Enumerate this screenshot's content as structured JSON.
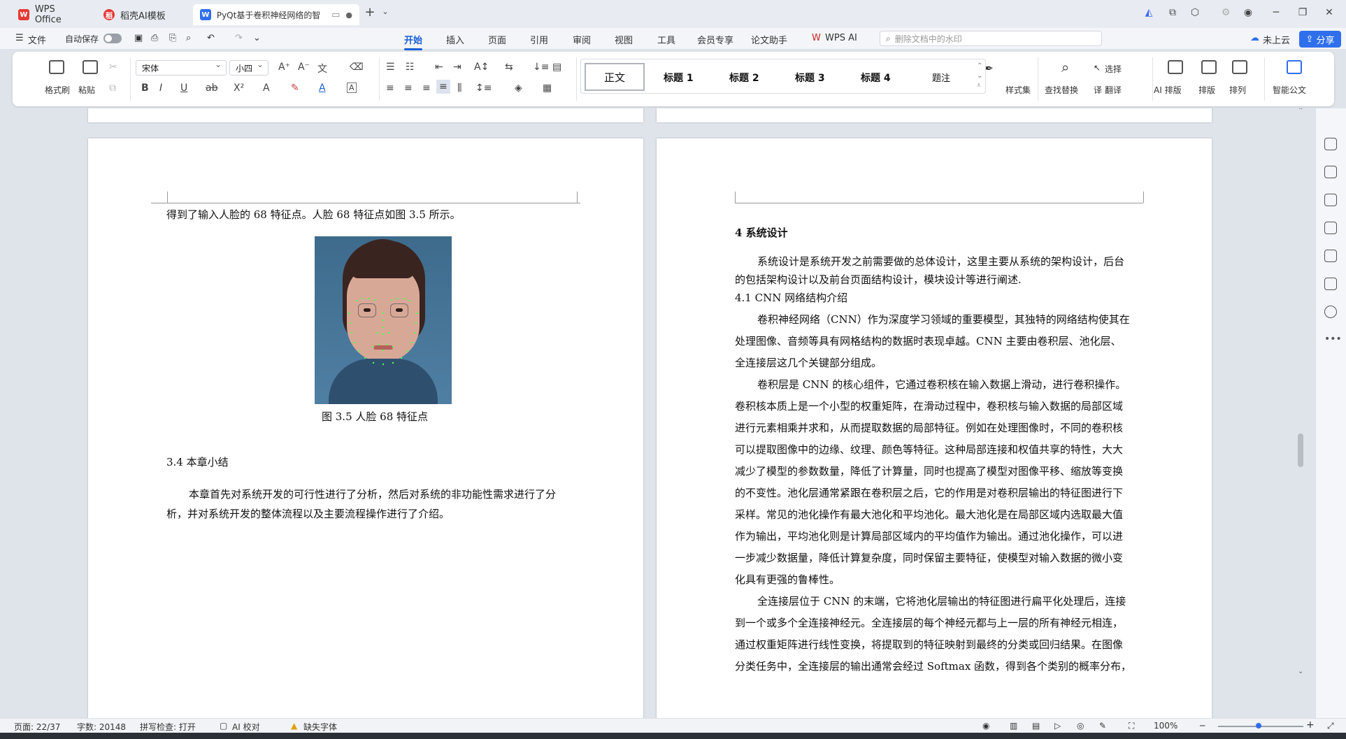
{
  "tabs": [
    {
      "label": "WPS Office"
    },
    {
      "label": "稻壳AI模板"
    },
    {
      "label": "PyQt基于卷积神经网络的智"
    }
  ],
  "menu": {
    "file": "文件",
    "autosave": "自动保存",
    "items": [
      "开始",
      "插入",
      "页面",
      "引用",
      "审阅",
      "视图",
      "工具",
      "会员专享",
      "论文助手",
      "WPS AI"
    ],
    "search_placeholder": "删除文档中的水印",
    "cloud": "未上云",
    "share": "分享"
  },
  "ribbon": {
    "format_painter": "格式刷",
    "paste": "粘贴",
    "font_name": "宋体",
    "font_size": "小四",
    "styles": [
      "正文",
      "标题 1",
      "标题 2",
      "标题 3",
      "标题 4",
      "题注"
    ],
    "style_set": "样式集",
    "find_replace": "查找替换",
    "select": "选择",
    "translate": "翻译",
    "ai_layout": "AI 排版",
    "layout": "排版",
    "arrange": "排列",
    "smart_doc": "智能公文"
  },
  "left_page": {
    "line1": "得到了输入人脸的  68  特征点。人脸  68  特征点如图 3.5  所示。",
    "caption": "图  3.5    人脸  68  特征点",
    "section": "3.4 本章小结",
    "para_l1": "本章首先对系统开发的可行性进行了分析，然后对系统的非功能性需求进行了分",
    "para_l2": "析，并对系统开发的整体流程以及主要流程操作进行了介绍。"
  },
  "right_page": {
    "heading": "4  系统设计",
    "lines": [
      "系统设计是系统开发之前需要做的总体设计，这里主要从系统的架构设计，后台",
      "的包括架构设计以及前台页面结构设计，模块设计等进行阐述.",
      "4.1 CNN   网络结构介绍",
      "卷积神经网络（CNN）作为深度学习领域的重要模型，其独特的网络结构使其在",
      "处理图像、音频等具有网格结构的数据时表现卓越。CNN 主要由卷积层、池化层、",
      "全连接层这几个关键部分组成。",
      "卷积层是  CNN  的核心组件，它通过卷积核在输入数据上滑动，进行卷积操作。",
      "卷积核本质上是一个小型的权重矩阵，在滑动过程中，卷积核与输入数据的局部区域",
      "进行元素相乘并求和，从而提取数据的局部特征。例如在处理图像时，不同的卷积核",
      "可以提取图像中的边缘、纹理、颜色等特征。这种局部连接和权值共享的特性，大大",
      "减少了模型的参数数量，降低了计算量，同时也提高了模型对图像平移、缩放等变换",
      "的不变性。池化层通常紧跟在卷积层之后，它的作用是对卷积层输出的特征图进行下",
      "采样。常见的池化操作有最大池化和平均池化。最大池化是在局部区域内选取最大值",
      "作为输出，平均池化则是计算局部区域内的平均值作为输出。通过池化操作，可以进",
      "一步减少数据量，降低计算复杂度，同时保留主要特征，使模型对输入数据的微小变",
      "化具有更强的鲁棒性。",
      "全连接层位于  CNN  的末端，它将池化层输出的特征图进行扁平化处理后，连接",
      "到一个或多个全连接神经元。全连接层的每个神经元都与上一层的所有神经元相连，",
      "通过权重矩阵进行线性变换，将提取到的特征映射到最终的分类或回归结果。在图像",
      "分类任务中，全连接层的输出通常会经过  Softmax  函数，得到各个类别的概率分布，"
    ]
  },
  "status": {
    "page": "页面: 22/37",
    "words": "字数: 20148",
    "spell": "拼写检查: 打开",
    "ai_check": "AI 校对",
    "missing_font": "缺失字体",
    "zoom": "100%"
  }
}
